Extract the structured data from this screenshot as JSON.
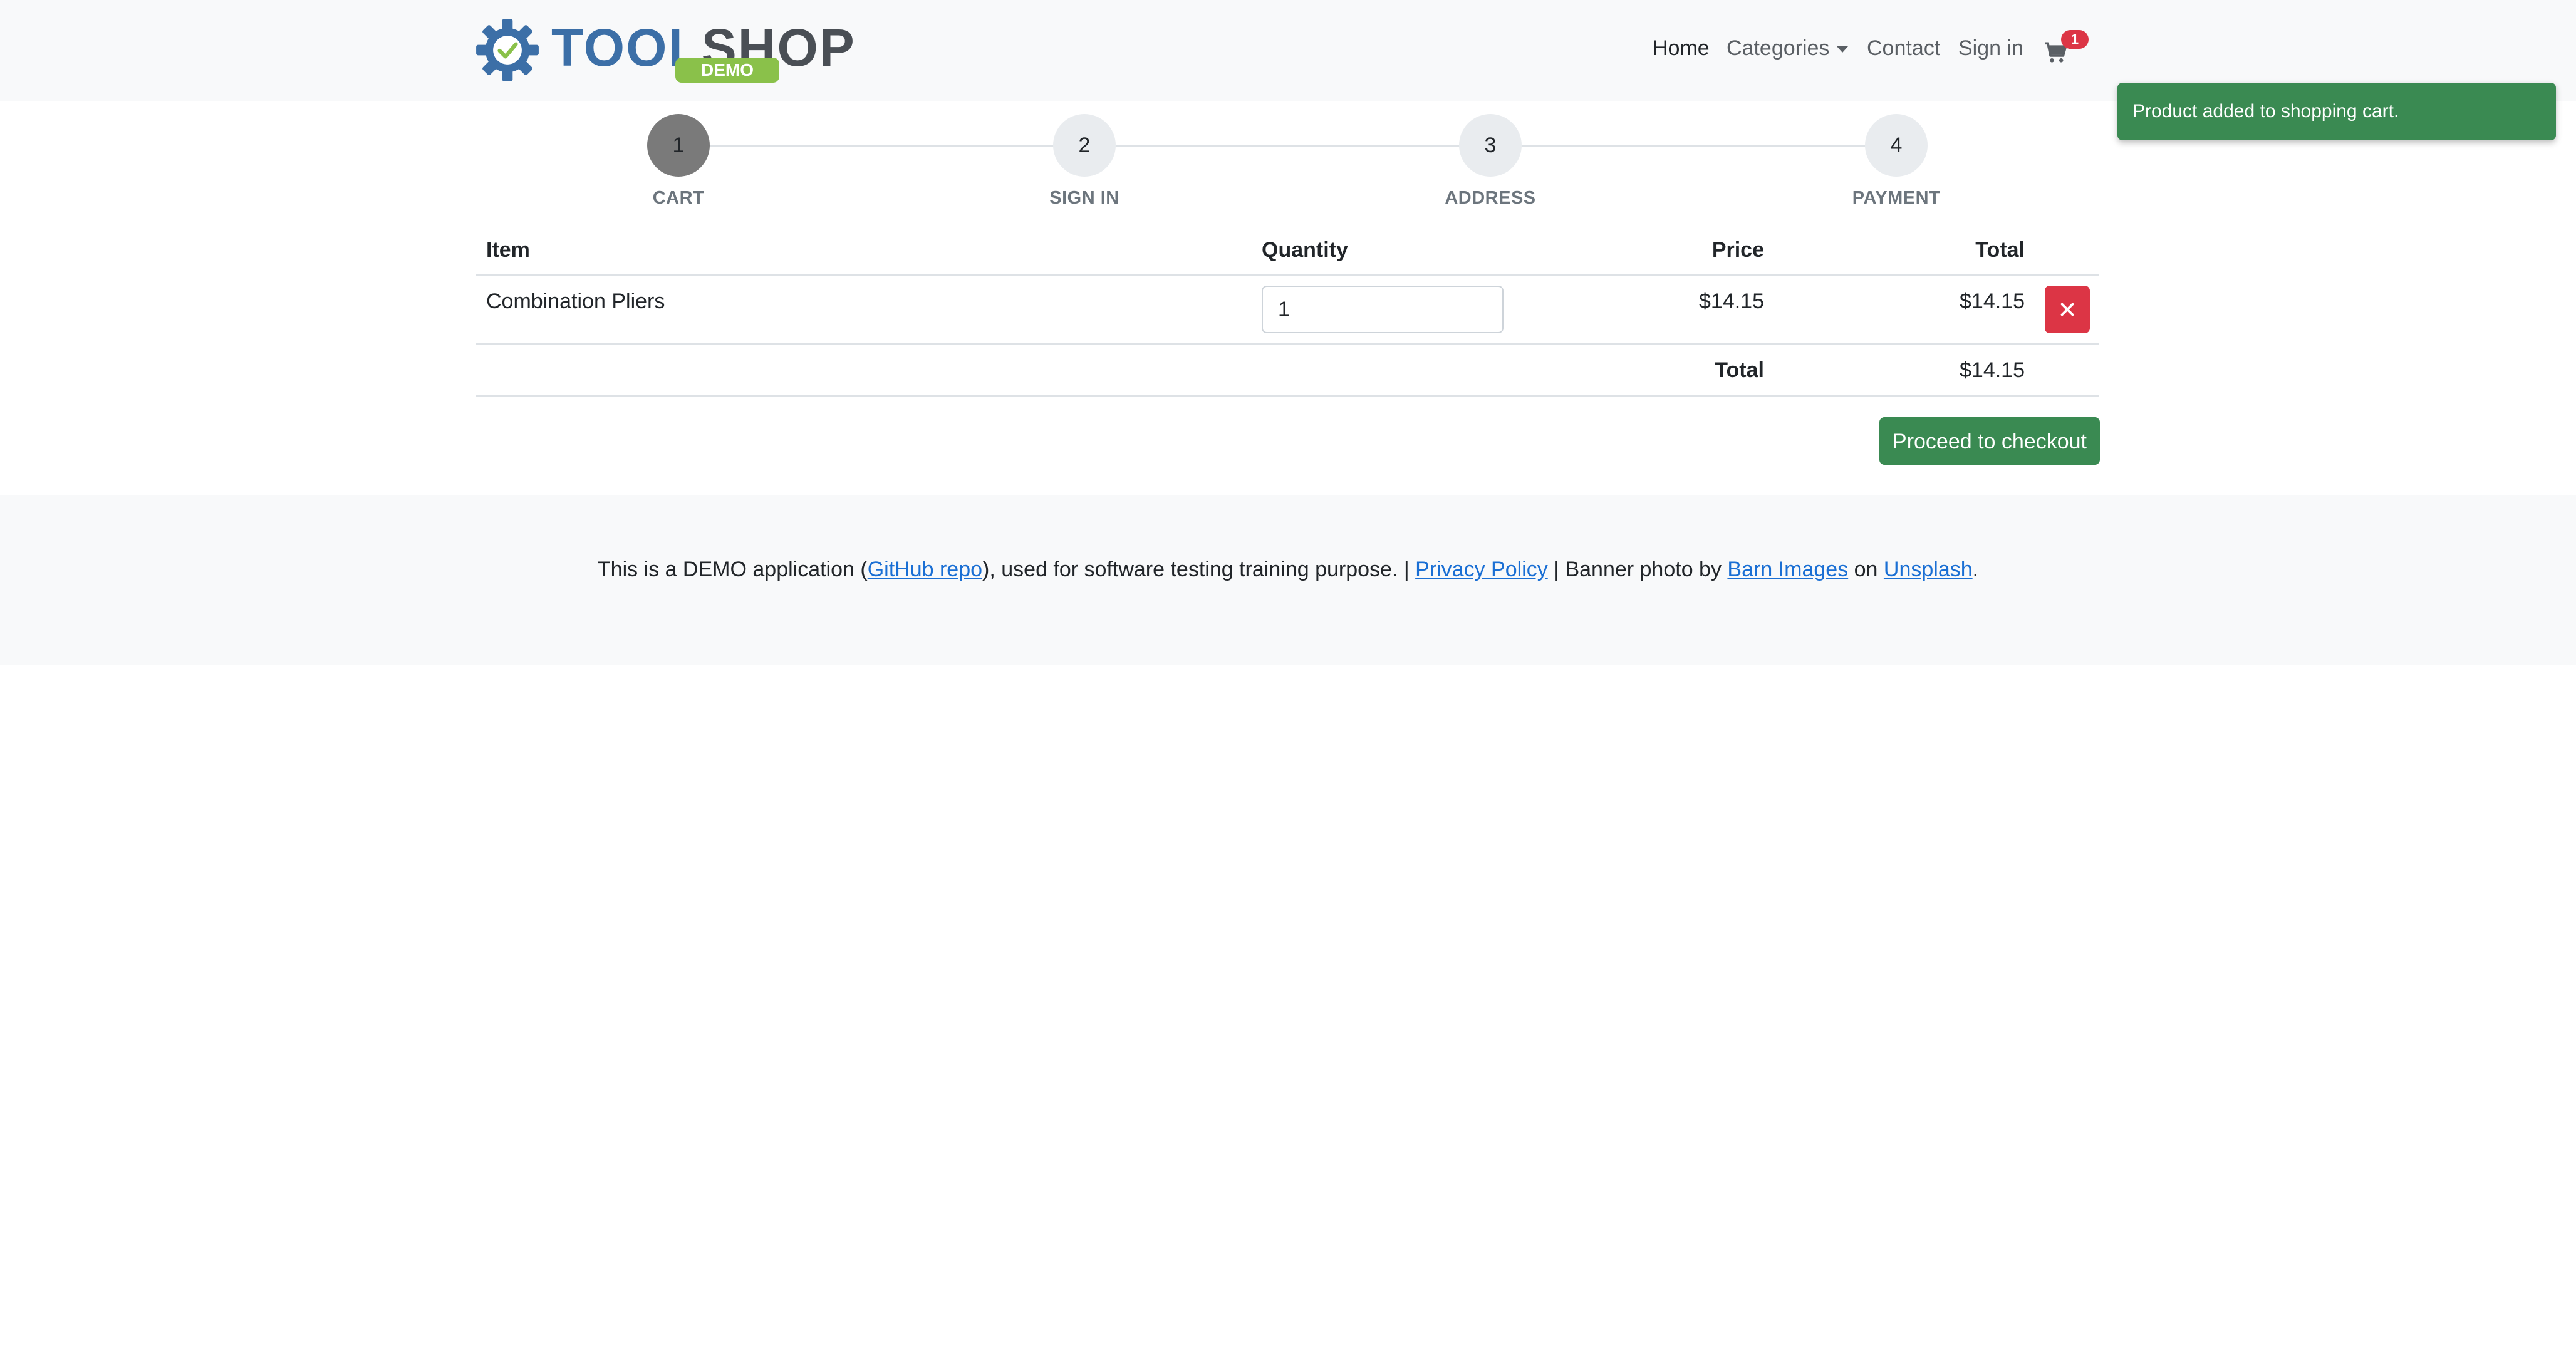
{
  "brand": {
    "logo_tool": "TOOL",
    "logo_shop": "SHOP",
    "logo_badge": "DEMO",
    "colors": {
      "tool": "#3c6fa7",
      "shop": "#4a4f55",
      "badge": "#8ac14a"
    }
  },
  "nav": {
    "home": "Home",
    "categories": "Categories",
    "contact": "Contact",
    "sign_in": "Sign in",
    "cart_icon": "shopping-cart-icon",
    "cart_count": "1"
  },
  "toast": {
    "message": "Product added to shopping cart.",
    "color": "#3a8a52"
  },
  "steps": [
    {
      "number": "1",
      "label": "CART",
      "active": true
    },
    {
      "number": "2",
      "label": "SIGN IN",
      "active": false
    },
    {
      "number": "3",
      "label": "ADDRESS",
      "active": false
    },
    {
      "number": "4",
      "label": "PAYMENT",
      "active": false
    }
  ],
  "cart_table": {
    "headers": {
      "item": "Item",
      "quantity": "Quantity",
      "price": "Price",
      "total": "Total"
    },
    "rows": [
      {
        "item": "Combination Pliers",
        "quantity": "1",
        "price": "$14.15",
        "total": "$14.15",
        "remove_icon": "close-icon"
      }
    ],
    "summary_label": "Total",
    "summary_value": "$14.15"
  },
  "checkout": {
    "label": "Proceed to checkout",
    "color": "#3a8a52"
  },
  "footer": {
    "text_1": "This is a DEMO application (",
    "github_link": "GitHub repo",
    "text_2": "), used for software testing training purpose. | ",
    "privacy_link": "Privacy Policy",
    "text_3": " | Banner photo by ",
    "barn_link": "Barn Images",
    "text_4": " on ",
    "unsplash_link": "Unsplash",
    "text_5": "."
  }
}
